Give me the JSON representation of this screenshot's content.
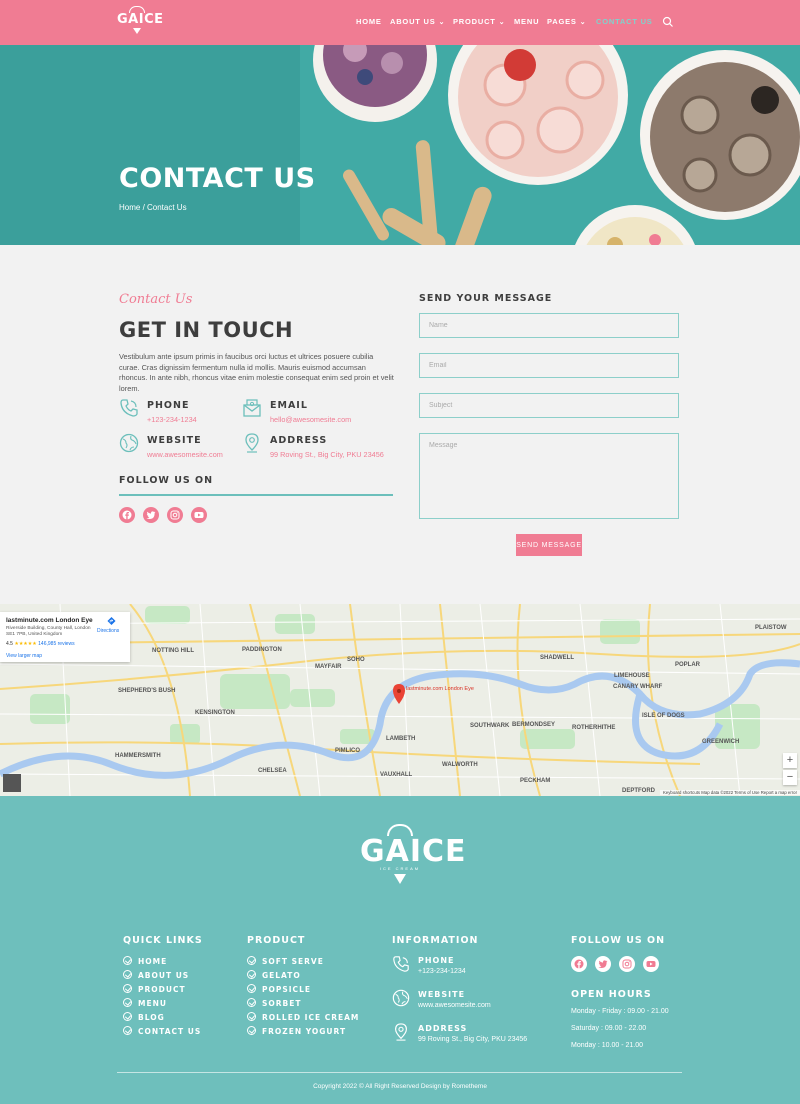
{
  "header": {
    "logo_text": "GAICE",
    "nav": [
      {
        "label": "HOME",
        "dropdown": false
      },
      {
        "label": "ABOUT US",
        "dropdown": true
      },
      {
        "label": "PRODUCT",
        "dropdown": true
      },
      {
        "label": "MENU",
        "dropdown": false
      },
      {
        "label": "PAGES",
        "dropdown": true
      },
      {
        "label": "CONTACT US",
        "dropdown": false,
        "active": true
      }
    ]
  },
  "hero": {
    "title": "CONTACT US",
    "breadcrumb": "Home / Contact Us"
  },
  "contact": {
    "script_title": "Contact Us",
    "heading": "GET IN TOUCH",
    "intro": "Vestibulum ante ipsum primis in faucibus orci luctus et ultrices posuere cubilia curae. Cras dignissim fermentum nulla id mollis. Mauris euismod accumsan rhoncus. In ante nibh, rhoncus vitae enim molestie consequat enim sed proin et velit lorem.",
    "phone_label": "PHONE",
    "phone_value": "+123-234-1234",
    "email_label": "EMAIL",
    "email_value": "hello@awesomesite.com",
    "website_label": "WEBSITE",
    "website_value": "www.awesomesite.com",
    "address_label": "ADDRESS",
    "address_value": "99 Roving St., Big City, PKU 23456",
    "follow_title": "FOLLOW US ON",
    "socials": [
      "facebook-icon",
      "twitter-icon",
      "instagram-icon",
      "youtube-icon"
    ]
  },
  "form": {
    "title": "SEND YOUR MESSAGE",
    "name_placeholder": "Name",
    "email_placeholder": "Email",
    "subject_placeholder": "Subject",
    "message_placeholder": "Message",
    "send_label": "SEND MESSAGE"
  },
  "map": {
    "place_title": "lastminute.com London Eye",
    "place_address": "Riverside Building, County Hall, London SE1 7PB, United Kingdom",
    "rating": "4.5",
    "stars": "★★★★★",
    "reviews": "146,985 reviews",
    "view_larger": "View larger map",
    "directions": "Directions",
    "zoom_in": "+",
    "zoom_out": "−",
    "footer_text": "Keyboard shortcuts   Map data ©2022   Terms of Use   Report a map error",
    "labels": [
      "NOTTING HILL",
      "PADDINGTON",
      "MAYFAIR",
      "SOHO",
      "KENSINGTON",
      "CHELSEA",
      "LAMBETH",
      "SOUTHWARK",
      "SHADWELL",
      "LIMEHOUSE",
      "POPLAR",
      "CANARY WHARF",
      "ISLE OF DOGS",
      "GREENWICH",
      "ROTHERHITHE",
      "BERMONDSEY",
      "WALWORTH",
      "PECKHAM",
      "HAMMERSMITH",
      "SHEPHERD'S BUSH",
      "PIMLICO",
      "VAUXHALL",
      "DEPTFORD",
      "PLAISTOW"
    ],
    "pin_label": "lastminute.com London Eye"
  },
  "footer": {
    "logo_text": "GAICE",
    "logo_sub": "ICE CREAM",
    "quick_links_title": "QUICK LINKS",
    "quick_links": [
      "HOME",
      "ABOUT US",
      "PRODUCT",
      "MENU",
      "BLOG",
      "CONTACT US"
    ],
    "product_title": "PRODUCT",
    "products": [
      "SOFT SERVE",
      "GELATO",
      "POPSICLE",
      "SORBET",
      "ROLLED ICE CREAM",
      "FROZEN YOGURT"
    ],
    "information_title": "INFORMATION",
    "phone_label": "PHONE",
    "phone_value": "+123-234-1234",
    "website_label": "WEBSITE",
    "website_value": "www.awesomesite.com",
    "address_label": "ADDRESS",
    "address_value": "99 Roving St., Big City, PKU 23456",
    "follow_title": "FOLLOW US ON",
    "open_hours_title": "OPEN HOURS",
    "hours": [
      "Monday - Friday : 09.00 - 21.00",
      "Saturday : 09.00 - 22.00",
      "Monday : 10.00 - 21.00"
    ],
    "copyright": "Copyright 2022 © All Right Reserved Design by Rometheme"
  },
  "colors": {
    "brand_pink": "#f07c93",
    "teal": "#6ebfbc",
    "hero_teal": "#3fa9a4"
  }
}
